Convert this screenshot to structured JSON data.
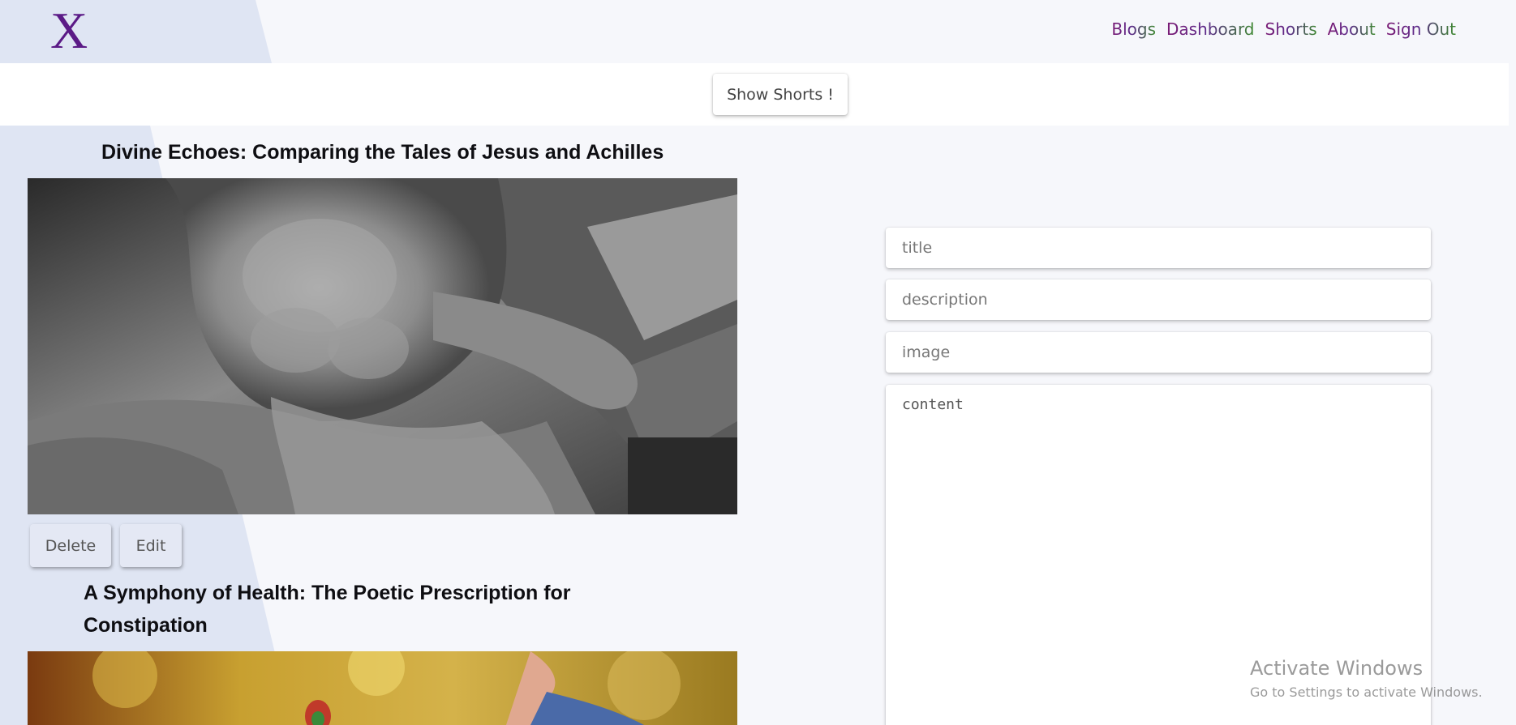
{
  "header": {
    "logo": "X",
    "nav": [
      "Blogs",
      "Dashboard",
      "Shorts",
      "About",
      "Sign Out"
    ]
  },
  "shorts_button": "Show Shorts !",
  "posts": [
    {
      "title": "Divine Echoes: Comparing the Tales of Jesus and Achilles",
      "delete_label": "Delete",
      "edit_label": "Edit"
    },
    {
      "title": "A Symphony of Health: The Poetic Prescription for Constipation"
    }
  ],
  "form": {
    "title_placeholder": "title",
    "description_placeholder": "description",
    "image_placeholder": "image",
    "content_placeholder": "content"
  },
  "watermark": {
    "line1": "Activate Windows",
    "line2": "Go to Settings to activate Windows."
  },
  "colors": {
    "logo": "#5b1a86",
    "nav_gradient_start": "#7a1a74",
    "nav_gradient_end": "#3c8a2e",
    "page_background": "#f6f7fb",
    "accent_wedge": "#dfe5f3"
  }
}
